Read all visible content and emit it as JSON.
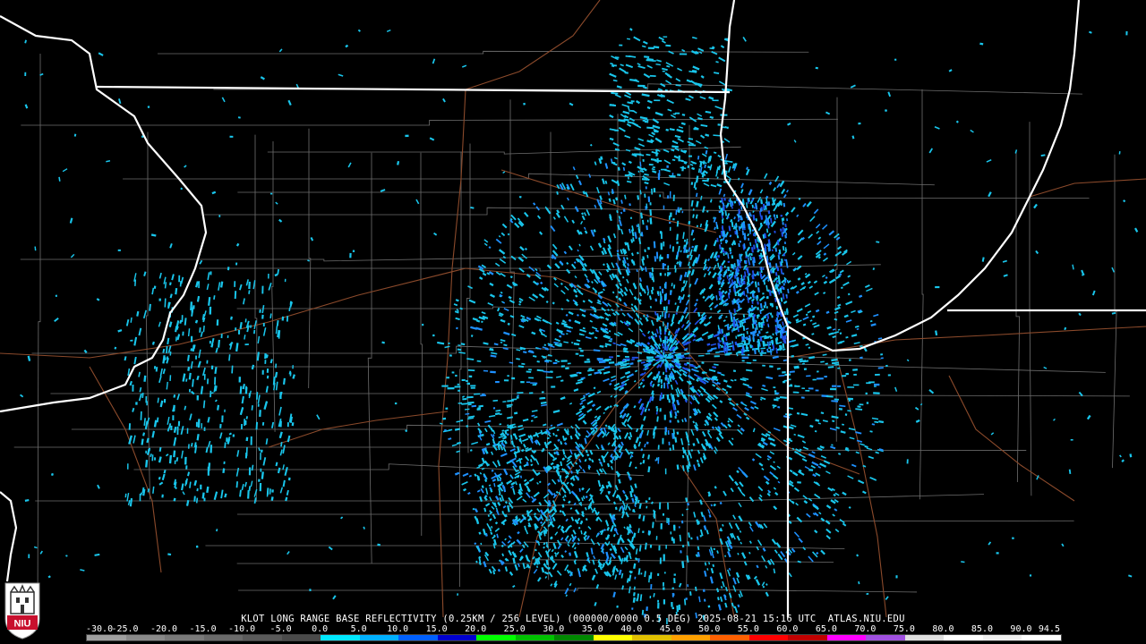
{
  "header": {
    "product_line": "KLOT LONG RANGE BASE REFLECTIVITY (0.25KM / 256 LEVEL) (000000/0000 0.5 DEG) 2025-08-21 15:16 UTC  ATLAS.NIU.EDU"
  },
  "scale": {
    "labels": [
      "-30.0",
      "-25.0",
      "-20.0",
      "-15.0",
      "-10.0",
      "-5.0",
      "0.0",
      "5.0",
      "10.0",
      "15.0",
      "20.0",
      "25.0",
      "30.0",
      "35.0",
      "40.0",
      "45.0",
      "50.0",
      "55.0",
      "60.0",
      "65.0",
      "70.0",
      "75.0",
      "80.0",
      "85.0",
      "90.0",
      "94.5"
    ],
    "colors": [
      "#a0a0a0",
      "#8a8a8a",
      "#7a7a7a",
      "#6a6a6a",
      "#5a5a5a",
      "#4a4a4a",
      "#00e8ff",
      "#00b0ff",
      "#0060ff",
      "#0000d0",
      "#00ff00",
      "#00c000",
      "#008800",
      "#ffff00",
      "#e0c000",
      "#ffa000",
      "#ff6000",
      "#ff0000",
      "#c00000",
      "#ff00ff",
      "#a050e0",
      "#e0e0e0",
      "#ffffff",
      "#f0f0f0",
      "#ffffff"
    ]
  },
  "logo": {
    "text": "NIU",
    "brand_color": "#c8102e"
  },
  "map_colors": {
    "state_borders": "#ffffff",
    "county_lines": "#6e6e6e",
    "highways": "#8b4a2b",
    "echo_light": "#19c6ec",
    "echo_mid": "#1e90ff",
    "echo_strong": "#2050e8"
  }
}
